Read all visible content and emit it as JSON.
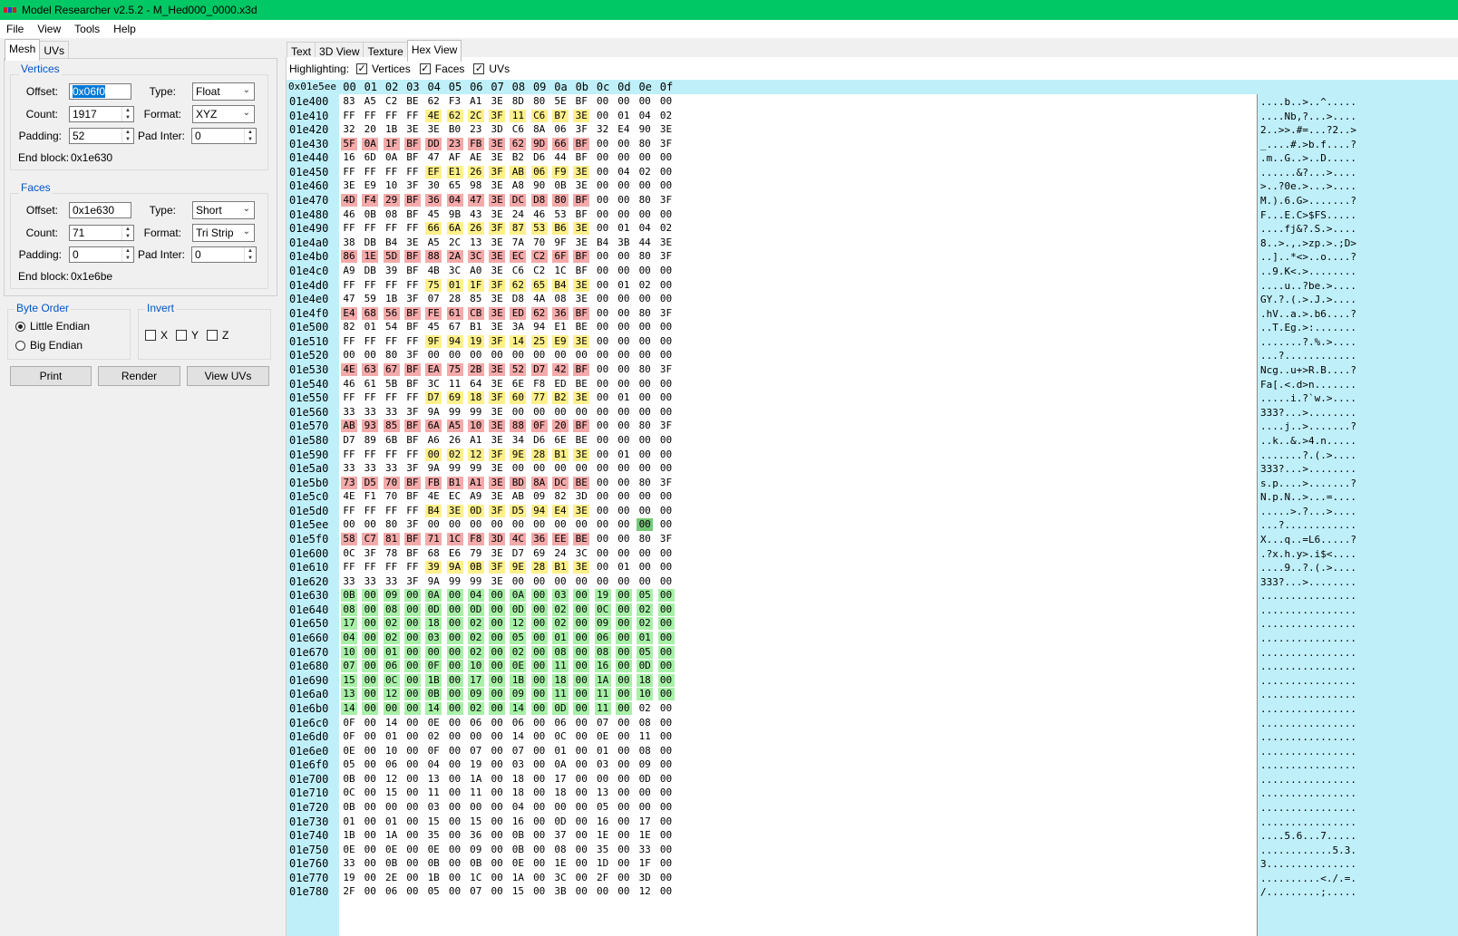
{
  "titlebar": {
    "title": "Model Researcher v2.5.2 - M_Hed000_0000.x3d"
  },
  "menu": [
    "File",
    "View",
    "Tools",
    "Help"
  ],
  "left_tabs": [
    "Mesh",
    "UVs"
  ],
  "vertices": {
    "legend": "Vertices",
    "offset_label": "Offset:",
    "offset": "0x06f0",
    "type_label": "Type:",
    "type": "Float",
    "count_label": "Count:",
    "count": "1917",
    "format_label": "Format:",
    "format": "XYZ",
    "padding_label": "Padding:",
    "padding": "52",
    "padinter_label": "Pad Inter:",
    "padinter": "0",
    "endblock_label": "End block:",
    "endblock": "0x1e630"
  },
  "faces": {
    "legend": "Faces",
    "offset_label": "Offset:",
    "offset": "0x1e630",
    "type_label": "Type:",
    "type": "Short",
    "count_label": "Count:",
    "count": "71",
    "format_label": "Format:",
    "format": "Tri Strip",
    "padding_label": "Padding:",
    "padding": "0",
    "padinter_label": "Pad Inter:",
    "padinter": "0",
    "endblock_label": "End block:",
    "endblock": "0x1e6be"
  },
  "byte_order": {
    "legend": "Byte Order",
    "little": "Little Endian",
    "big": "Big Endian",
    "selected": "little"
  },
  "invert": {
    "legend": "Invert",
    "x": "X",
    "y": "Y",
    "z": "Z"
  },
  "buttons": {
    "print": "Print",
    "render": "Render",
    "view_uvs": "View UVs"
  },
  "right_tabs": [
    "Text",
    "3D View",
    "Texture",
    "Hex View"
  ],
  "highlighting": {
    "label": "Highlighting:",
    "vertices": "Vertices",
    "faces": "Faces",
    "uvs": "UVs"
  },
  "colors": {
    "titlebar": "#00c864",
    "vertex_y": "#fff08c",
    "vertex_r": "#f4aaaa",
    "face_g": "#a8f0a8",
    "header_bg": "#bff0fa"
  },
  "hex": {
    "current_offset": "0x01e5ee",
    "columns": [
      "00",
      "01",
      "02",
      "03",
      "04",
      "05",
      "06",
      "07",
      "08",
      "09",
      "0a",
      "0b",
      "0c",
      "0d",
      "0e",
      "0f"
    ],
    "rows": [
      {
        "a": "01e400",
        "b": "83 A5 C2 BE 62 F3 A1 3E 8D 80 5E BF 00 00 00 00",
        "h": "................",
        "t": "....b..>..^....."
      },
      {
        "a": "01e410",
        "b": "FF FF FF FF 4E 62 2C 3F 11 C6 B7 3E 00 01 04 02",
        "h": "....yyyyyyyy....",
        "t": "....Nb,?...>...."
      },
      {
        "a": "01e420",
        "b": "32 20 1B 3E 3E B0 23 3D C6 8A 06 3F 32 E4 90 3E",
        "h": "................",
        "t": "2..>>.#=...?2..>"
      },
      {
        "a": "01e430",
        "b": "5F 0A 1F BF DD 23 FB 3E 62 9D 66 BF 00 00 80 3F",
        "h": "rrrrrrrrrrrr....",
        "t": "_....#.>b.f....?"
      },
      {
        "a": "01e440",
        "b": "16 6D 0A BF 47 AF AE 3E B2 D6 44 BF 00 00 00 00",
        "h": "................",
        "t": ".m..G..>..D....."
      },
      {
        "a": "01e450",
        "b": "FF FF FF FF EF E1 26 3F AB 06 F9 3E 00 04 02 00",
        "h": "....yyyyyyyy....",
        "t": "......&?...>...."
      },
      {
        "a": "01e460",
        "b": "3E E9 10 3F 30 65 98 3E A8 90 0B 3E 00 00 00 00",
        "h": "................",
        "t": ">..?0e.>...>...."
      },
      {
        "a": "01e470",
        "b": "4D F4 29 BF 36 04 47 3E DC D8 80 BF 00 00 80 3F",
        "h": "rrrrrrrrrrrr....",
        "t": "M.).6.G>.......?"
      },
      {
        "a": "01e480",
        "b": "46 0B 08 BF 45 9B 43 3E 24 46 53 BF 00 00 00 00",
        "h": "................",
        "t": "F...E.C>$FS....."
      },
      {
        "a": "01e490",
        "b": "FF FF FF FF 66 6A 26 3F 87 53 B6 3E 00 01 04 02",
        "h": "....yyyyyyyy....",
        "t": "....fj&?.S.>...."
      },
      {
        "a": "01e4a0",
        "b": "38 DB B4 3E A5 2C 13 3E 7A 70 9F 3E B4 3B 44 3E",
        "h": "................",
        "t": "8..>.,.>zp.>.;D>"
      },
      {
        "a": "01e4b0",
        "b": "86 1E 5D BF 88 2A 3C 3E EC C2 6F BF 00 00 80 3F",
        "h": "rrrrrrrrrrrr....",
        "t": "..]..*<>..o....?"
      },
      {
        "a": "01e4c0",
        "b": "A9 DB 39 BF 4B 3C A0 3E C6 C2 1C BF 00 00 00 00",
        "h": "................",
        "t": "..9.K<.>........"
      },
      {
        "a": "01e4d0",
        "b": "FF FF FF FF 75 01 1F 3F 62 65 B4 3E 00 01 02 00",
        "h": "....yyyyyyyy....",
        "t": "....u..?be.>...."
      },
      {
        "a": "01e4e0",
        "b": "47 59 1B 3F 07 28 85 3E D8 4A 08 3E 00 00 00 00",
        "h": "................",
        "t": "GY.?.(.>.J.>...."
      },
      {
        "a": "01e4f0",
        "b": "E4 68 56 BF FE 61 CB 3E ED 62 36 BF 00 00 80 3F",
        "h": "rrrrrrrrrrrr....",
        "t": ".hV..a.>.b6....?"
      },
      {
        "a": "01e500",
        "b": "82 01 54 BF 45 67 B1 3E 3A 94 E1 BE 00 00 00 00",
        "h": "................",
        "t": "..T.Eg.>:......."
      },
      {
        "a": "01e510",
        "b": "FF FF FF FF 9F 94 19 3F 14 25 E9 3E 00 00 00 00",
        "h": "....yyyyyyyy....",
        "t": ".......?.%.>...."
      },
      {
        "a": "01e520",
        "b": "00 00 80 3F 00 00 00 00 00 00 00 00 00 00 00 00",
        "h": "................",
        "t": "...?............"
      },
      {
        "a": "01e530",
        "b": "4E 63 67 BF EA 75 2B 3E 52 D7 42 BF 00 00 80 3F",
        "h": "rrrrrrrrrrrr....",
        "t": "Ncg..u+>R.B....?"
      },
      {
        "a": "01e540",
        "b": "46 61 5B BF 3C 11 64 3E 6E F8 ED BE 00 00 00 00",
        "h": "................",
        "t": "Fa[.<.d>n......."
      },
      {
        "a": "01e550",
        "b": "FF FF FF FF D7 69 18 3F 60 77 B2 3E 00 01 00 00",
        "h": "....yyyyyyyy....",
        "t": ".....i.?`w.>...."
      },
      {
        "a": "01e560",
        "b": "33 33 33 3F 9A 99 99 3E 00 00 00 00 00 00 00 00",
        "h": "................",
        "t": "333?...>........"
      },
      {
        "a": "01e570",
        "b": "AB 93 85 BF 6A A5 10 3E 88 0F 20 BF 00 00 80 3F",
        "h": "rrrrrrrrrrrr....",
        "t": "....j..>.......?"
      },
      {
        "a": "01e580",
        "b": "D7 89 6B BF A6 26 A1 3E 34 D6 6E BE 00 00 00 00",
        "h": "................",
        "t": "..k..&.>4.n....."
      },
      {
        "a": "01e590",
        "b": "FF FF FF FF 00 02 12 3F 9E 28 B1 3E 00 01 00 00",
        "h": "....yyyyyyyy....",
        "t": ".......?.(.>...."
      },
      {
        "a": "01e5a0",
        "b": "33 33 33 3F 9A 99 99 3E 00 00 00 00 00 00 00 00",
        "h": "................",
        "t": "333?...>........"
      },
      {
        "a": "01e5b0",
        "b": "73 D5 70 BF FB B1 A1 3E BD 8A DC BE 00 00 80 3F",
        "h": "rrrrrrrrrrrr....",
        "t": "s.p....>.......?"
      },
      {
        "a": "01e5c0",
        "b": "4E F1 70 BF 4E EC A9 3E AB 09 82 3D 00 00 00 00",
        "h": "................",
        "t": "N.p.N..>...=...."
      },
      {
        "a": "01e5d0",
        "b": "FF FF FF FF B4 3E 0D 3F D5 94 E4 3E 00 00 00 00",
        "h": "....yyyyyyyy....",
        "t": ".....>.?...>...."
      },
      {
        "a": "01e5ee",
        "b": "00 00 80 3F 00 00 00 00 00 00 00 00 00 00 00 00",
        "h": "..............s.",
        "t": "...?............"
      },
      {
        "a": "01e5f0",
        "b": "58 C7 81 BF 71 1C F8 3D 4C 36 EE BE 00 00 80 3F",
        "h": "rrrrrrrrrrrr....",
        "t": "X...q..=L6.....?"
      },
      {
        "a": "01e600",
        "b": "0C 3F 78 BF 68 E6 79 3E D7 69 24 3C 00 00 00 00",
        "h": "................",
        "t": ".?x.h.y>.i$<...."
      },
      {
        "a": "01e610",
        "b": "FF FF FF FF 39 9A 0B 3F 9E 28 B1 3E 00 01 00 00",
        "h": "....yyyyyyyy....",
        "t": "....9..?.(.>...."
      },
      {
        "a": "01e620",
        "b": "33 33 33 3F 9A 99 99 3E 00 00 00 00 00 00 00 00",
        "h": "................",
        "t": "333?...>........"
      },
      {
        "a": "01e630",
        "b": "0B 00 09 00 0A 00 04 00 0A 00 03 00 19 00 05 00",
        "h": "gggggggggggggggg",
        "t": "................"
      },
      {
        "a": "01e640",
        "b": "08 00 08 00 0D 00 0D 00 0D 00 02 00 0C 00 02 00",
        "h": "gggggggggggggggg",
        "t": "................"
      },
      {
        "a": "01e650",
        "b": "17 00 02 00 18 00 02 00 12 00 02 00 09 00 02 00",
        "h": "gggggggggggggggg",
        "t": "................"
      },
      {
        "a": "01e660",
        "b": "04 00 02 00 03 00 02 00 05 00 01 00 06 00 01 00",
        "h": "gggggggggggggggg",
        "t": "................"
      },
      {
        "a": "01e670",
        "b": "10 00 01 00 00 00 02 00 02 00 08 00 08 00 05 00",
        "h": "gggggggggggggggg",
        "t": "................"
      },
      {
        "a": "01e680",
        "b": "07 00 06 00 0F 00 10 00 0E 00 11 00 16 00 0D 00",
        "h": "gggggggggggggggg",
        "t": "................"
      },
      {
        "a": "01e690",
        "b": "15 00 0C 00 1B 00 17 00 1B 00 18 00 1A 00 18 00",
        "h": "gggggggggggggggg",
        "t": "................"
      },
      {
        "a": "01e6a0",
        "b": "13 00 12 00 0B 00 09 00 09 00 11 00 11 00 10 00",
        "h": "gggggggggggggggg",
        "t": "................"
      },
      {
        "a": "01e6b0",
        "b": "14 00 00 00 14 00 02 00 14 00 0D 00 11 00 02 00",
        "h": "gggggggggggggg..",
        "t": "................"
      },
      {
        "a": "01e6c0",
        "b": "0F 00 14 00 0E 00 06 00 06 00 06 00 07 00 08 00",
        "h": "................",
        "t": "................"
      },
      {
        "a": "01e6d0",
        "b": "0F 00 01 00 02 00 00 00 14 00 0C 00 0E 00 11 00",
        "h": "................",
        "t": "................"
      },
      {
        "a": "01e6e0",
        "b": "0E 00 10 00 0F 00 07 00 07 00 01 00 01 00 08 00",
        "h": "................",
        "t": "................"
      },
      {
        "a": "01e6f0",
        "b": "05 00 06 00 04 00 19 00 03 00 0A 00 03 00 09 00",
        "h": "................",
        "t": "................"
      },
      {
        "a": "01e700",
        "b": "0B 00 12 00 13 00 1A 00 18 00 17 00 00 00 0D 00",
        "h": "................",
        "t": "................"
      },
      {
        "a": "01e710",
        "b": "0C 00 15 00 11 00 11 00 18 00 18 00 13 00 00 00",
        "h": "................",
        "t": "................"
      },
      {
        "a": "01e720",
        "b": "0B 00 00 00 03 00 00 00 04 00 00 00 05 00 00 00",
        "h": "................",
        "t": "................"
      },
      {
        "a": "01e730",
        "b": "01 00 01 00 15 00 15 00 16 00 0D 00 16 00 17 00",
        "h": "................",
        "t": "................"
      },
      {
        "a": "01e740",
        "b": "1B 00 1A 00 35 00 36 00 0B 00 37 00 1E 00 1E 00",
        "h": "................",
        "t": "....5.6...7....."
      },
      {
        "a": "01e750",
        "b": "0E 00 0E 00 0E 00 09 00 0B 00 08 00 35 00 33 00",
        "h": "................",
        "t": "............5.3."
      },
      {
        "a": "01e760",
        "b": "33 00 0B 00 0B 00 0B 00 0E 00 1E 00 1D 00 1F 00",
        "h": "................",
        "t": "3..............."
      },
      {
        "a": "01e770",
        "b": "19 00 2E 00 1B 00 1C 00 1A 00 3C 00 2F 00 3D 00",
        "h": "................",
        "t": "..........<./.=."
      },
      {
        "a": "01e780",
        "b": "2F 00 06 00 05 00 07 00 15 00 3B 00 00 00 12 00",
        "h": "................",
        "t": "/.........;....."
      }
    ]
  }
}
